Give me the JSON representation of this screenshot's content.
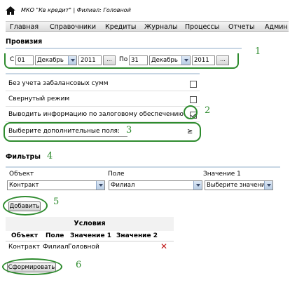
{
  "header": {
    "org_title": "МКО \"Кв кредит\"  |  Филиал: Головной"
  },
  "menu": [
    {
      "label": "Главная"
    },
    {
      "label": "Справочники"
    },
    {
      "label": "Кредиты"
    },
    {
      "label": "Журналы"
    },
    {
      "label": "Процессы"
    },
    {
      "label": "Отчеты"
    },
    {
      "label": "Админ"
    }
  ],
  "report": {
    "title": "Провизия",
    "from_label": "С",
    "from_day": "01",
    "from_month": "Декабрь",
    "from_year": "2011",
    "to_label": "По",
    "to_day": "31",
    "to_month": "Декабрь",
    "to_year": "2011",
    "dots": "..."
  },
  "options": [
    {
      "label": "Без учета забалансовых сумм",
      "checked": false
    },
    {
      "label": "Свернутый режим",
      "checked": false
    },
    {
      "label": "Выводить информацию по залоговому обеспечению",
      "checked": true
    }
  ],
  "extra_fields": {
    "label": "Выберите дополнительные поля:",
    "toggle": "≥"
  },
  "filters": {
    "title": "Фильтры",
    "col_object": "Объект",
    "col_field": "Поле",
    "col_value": "Значение 1",
    "object_value": "Контракт",
    "field_value": "Филиал",
    "value_value": "Выберите значение",
    "add_button": "Добавить"
  },
  "conditions": {
    "title": "Условия",
    "headers": [
      "Объект",
      "Поле",
      "Значение 1",
      "Значение 2"
    ],
    "rows": [
      {
        "object": "Контракт",
        "field": "Филиал",
        "value1": "Головной",
        "value2": ""
      }
    ],
    "delete": "✕"
  },
  "submit_button": "Сформировать",
  "annotations": [
    "1",
    "2",
    "3",
    "4",
    "5",
    "6"
  ],
  "colors": {
    "annotation": "#2e8b2e",
    "delete": "#c01818",
    "rule": "#c8d6e4"
  }
}
